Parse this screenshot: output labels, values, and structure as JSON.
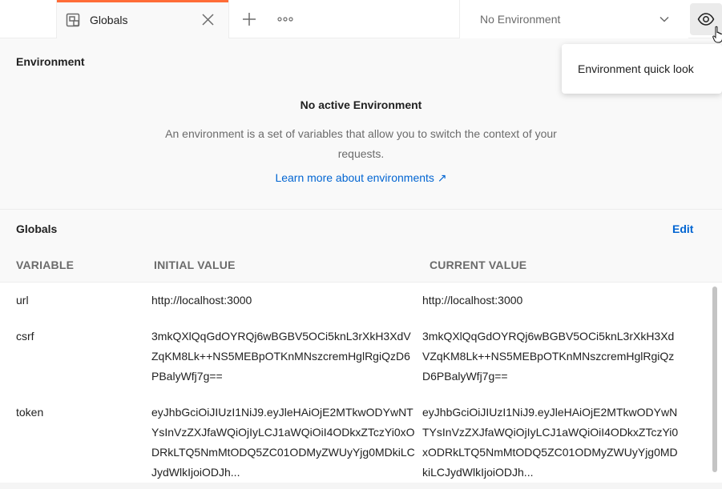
{
  "tabs": [
    {
      "label": "Globals",
      "icon": "globals-tab-icon"
    }
  ],
  "toolbar": {
    "new_tab_icon": "plus-icon",
    "more_tabs_icon": "ellipsis-icon"
  },
  "environment_selector": {
    "selected": "No Environment",
    "icon": "chevron-down-icon"
  },
  "quick_look": {
    "button_icon": "eye-icon",
    "tooltip": "Environment quick look"
  },
  "environment_section": {
    "title": "Environment",
    "empty_title": "No active Environment",
    "empty_description": "An environment is a set of variables that allow you to switch the context of your requests.",
    "learn_more": "Learn more about environments ↗"
  },
  "globals_section": {
    "title": "Globals",
    "edit_label": "Edit",
    "columns": [
      "VARIABLE",
      "INITIAL VALUE",
      "CURRENT VALUE"
    ],
    "rows": [
      {
        "variable": "url",
        "initial": "http://localhost:3000",
        "current": "http://localhost:3000"
      },
      {
        "variable": "csrf",
        "initial": "3mkQXlQqGdOYRQj6wBGBV5OCi5knL3rXkH3XdVZqKM8Lk++NS5MEBpOTKnMNszcremHglRgiQzD6PBalyWfj7g==",
        "current": "3mkQXlQqGdOYRQj6wBGBV5OCi5knL3rXkH3XdVZqKM8Lk++NS5MEBpOTKnMNszcremHglRgiQzD6PBalyWfj7g=="
      },
      {
        "variable": "token",
        "initial": "eyJhbGciOiJIUzI1NiJ9.eyJleHAiOjE2MTkwODYwNTYsInVzZXJfaWQiOjIyLCJ1aWQiOiI4ODkxZTczYi0xODRkLTQ5NmMtODQ5ZC01ODMyZWUyYjg0MDkiLCJydWlkIjoiODJh...",
        "current": "eyJhbGciOiJIUzI1NiJ9.eyJleHAiOjE2MTkwODYwNTYsInVzZXJfaWQiOjIyLCJ1aWQiOiI4ODkxZTczYi0xODRkLTQ5NmMtODQ5ZC01ODMyZWUyYjg0MDkiLCJydWlkIjoiODJh..."
      }
    ]
  },
  "colors": {
    "accent_tab": "#ff6c37",
    "link": "#0265d2",
    "muted_text": "#6b6b6b",
    "panel_bg": "#f9f9f9"
  }
}
